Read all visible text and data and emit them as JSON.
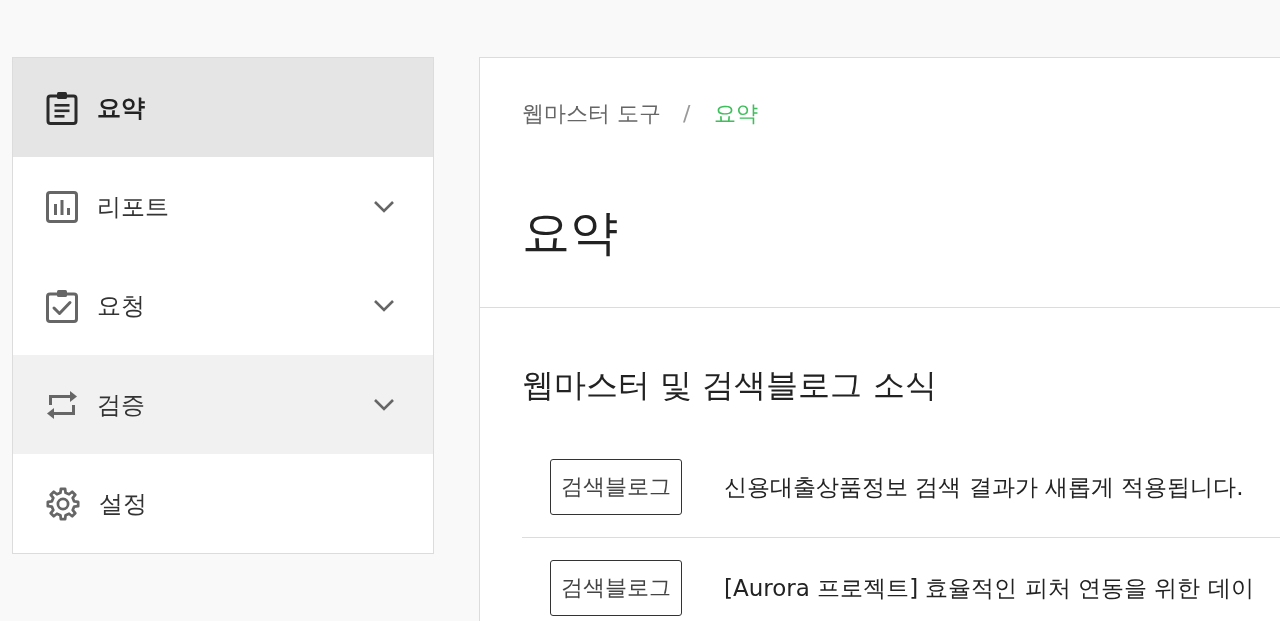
{
  "sidebar": {
    "items": [
      {
        "label": "요약",
        "kind": "link",
        "selected": true,
        "hovered": false
      },
      {
        "label": "리포트",
        "kind": "submenu",
        "selected": false,
        "hovered": false
      },
      {
        "label": "요청",
        "kind": "submenu",
        "selected": false,
        "hovered": false
      },
      {
        "label": "검증",
        "kind": "submenu",
        "selected": false,
        "hovered": true
      },
      {
        "label": "설정",
        "kind": "link",
        "selected": false,
        "hovered": false
      }
    ]
  },
  "breadcrumb": {
    "separator": "/",
    "items": [
      {
        "label": "웹마스터 도구",
        "selected": false
      },
      {
        "label": "요약",
        "selected": true
      }
    ]
  },
  "page_title": "요약",
  "news": {
    "heading": "웹마스터 및 검색블로그 소식",
    "items": [
      {
        "tag": "검색블로그",
        "title": "신용대출상품정보 검색 결과가 새롭게 적용됩니다."
      },
      {
        "tag": "검색블로그",
        "title": "[Aurora 프로젝트] 효율적인 피처 연동을 위한 데이"
      }
    ]
  }
}
